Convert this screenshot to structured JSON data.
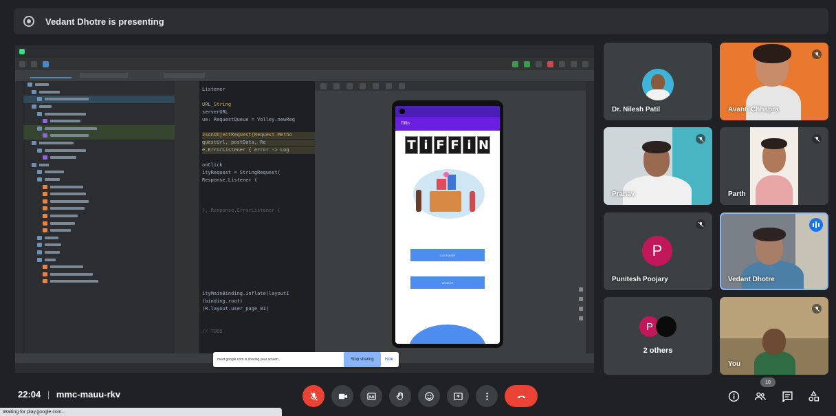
{
  "presenting_banner": "Vedant Dhotre is presenting",
  "shared_screen": {
    "editor_code": [
      "Listener",
      "",
      "URL_String",
      " serverURL",
      "ue: RequestQueue = Volley.newReq",
      "",
      "JsonObjectRequest(Request.Metho",
      "questUrl, postData, Re",
      "e.ErrorListener { error -> Log",
      "",
      "onClick",
      "ityRequest = StringRequest(",
      "Response.Listener {",
      "",
      "",
      "",
      "}, Response.ErrorListener {",
      "",
      "",
      "",
      "",
      "",
      "",
      "",
      "",
      "",
      "",
      "ityMainBinding.inflate(layoutI",
      "(binding.root)",
      "(R.layout.user_page_01)",
      "",
      "",
      "// TODO"
    ],
    "phone": {
      "app_title": "Tiffin",
      "logo_letters": [
        "T",
        "i",
        "F",
        "F",
        "i",
        "N"
      ],
      "button1": "CUSTOMER",
      "button2": "VENDOR"
    },
    "share_banner": {
      "text": "meet.google.com is sharing your screen.",
      "stop_label": "Stop sharing",
      "hide_label": "Hide"
    }
  },
  "participants": [
    {
      "name": "Dr. Nilesh Patil",
      "muted": false
    },
    {
      "name": "Avanti Chhapra",
      "muted": true
    },
    {
      "name": "Pranav",
      "muted": true
    },
    {
      "name": "Parth",
      "muted": true
    },
    {
      "name": "Punitesh Poojary",
      "initial": "P",
      "muted": true
    },
    {
      "name": "Vedant Dhotre",
      "speaking": true
    },
    {
      "others_initial": "P",
      "name": "2 others"
    },
    {
      "name": "You",
      "muted": true
    }
  ],
  "bottom_bar": {
    "time": "22:04",
    "separator": "|",
    "meeting_code": "mmc-mauu-rkv",
    "people_count": "10"
  },
  "browser_status": "Waiting for play.google.com...",
  "colors": {
    "end_call": "#ea4335",
    "control_bg": "#3c4043",
    "page_bg": "#202124",
    "avatar_pink": "#c2185b",
    "accent_blue": "#8ab4f8"
  }
}
